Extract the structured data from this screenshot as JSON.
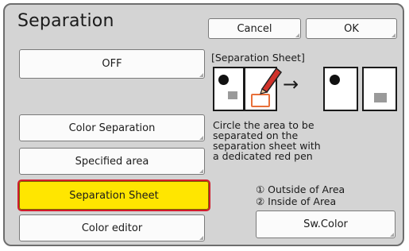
{
  "header": {
    "title": "Separation",
    "cancel_label": "Cancel",
    "ok_label": "OK"
  },
  "left_buttons": {
    "off_label": "OFF",
    "color_separation_label": "Color Separation",
    "specified_area_label": "Specified area",
    "separation_sheet_label": "Separation Sheet",
    "color_editor_label": "Color editor"
  },
  "info": {
    "heading": "[Separation Sheet]",
    "description_lines": [
      "Circle the area to be",
      "separated on the",
      "separation sheet with",
      "a dedicated red pen"
    ],
    "outputs": [
      "① Outside of Area",
      "② Inside of Area"
    ],
    "arrow": "→",
    "sw_color_label": "Sw.Color"
  },
  "colors": {
    "selected_fill": "#ffe600",
    "selected_border": "#d21c2c",
    "pen_circle": "#e8703a",
    "pen_red": "#d0322a"
  },
  "icons": [
    "sheet-with-marked-area-icon",
    "red-pen-icon",
    "arrow-right-icon",
    "outside-area-sheet-icon",
    "inside-area-sheet-icon"
  ]
}
